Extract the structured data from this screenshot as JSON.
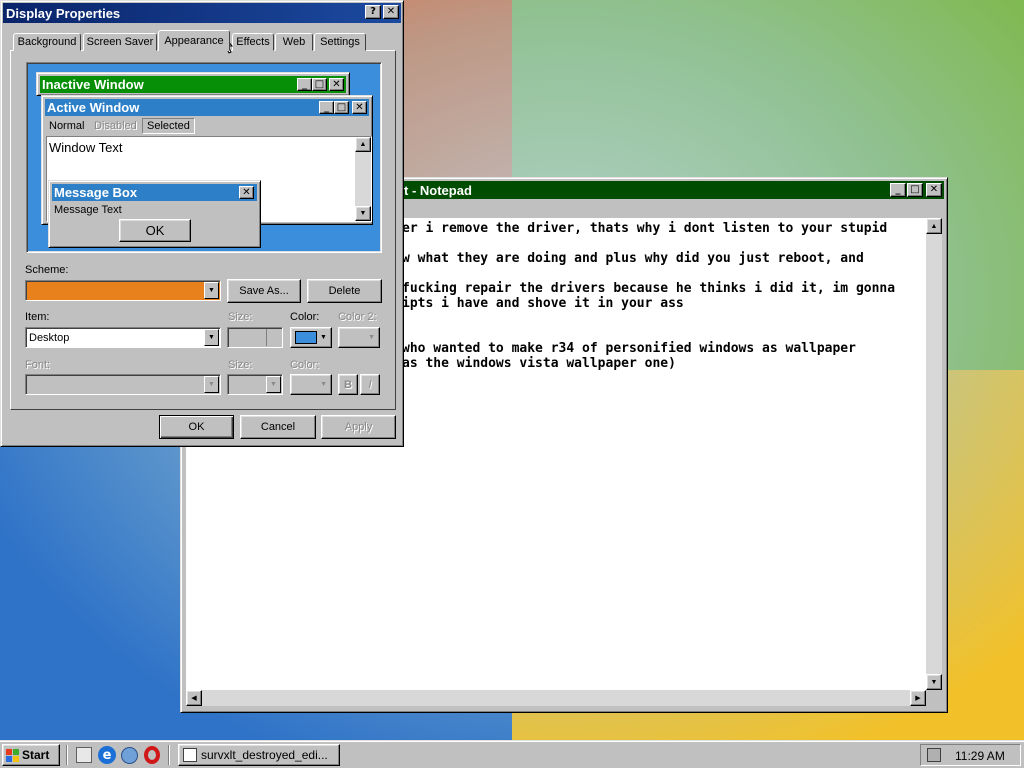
{
  "display_properties": {
    "title": "Display Properties",
    "help": "?",
    "close": "✕",
    "tabs": [
      "Background",
      "Screen Saver",
      "Appearance",
      "Effects",
      "Web",
      "Settings"
    ],
    "preview": {
      "inactive_title": "Inactive Window",
      "active_title": "Active Window",
      "menu": [
        "Normal",
        "Disabled",
        "Selected"
      ],
      "window_text": "Window Text",
      "message_box_title": "Message Box",
      "message_text": "Message Text",
      "ok": "OK"
    },
    "scheme_label": "Scheme:",
    "save_as": "Save As...",
    "delete": "Delete",
    "item_label": "Item:",
    "item_value": "Desktop",
    "size_label": "Size:",
    "color_label": "Color:",
    "color2_label": "Color 2:",
    "font_label": "Font:",
    "font_size_label": "Size:",
    "font_color_label": "Color:",
    "bold": "B",
    "italic": "I",
    "ok": "OK",
    "cancel": "Cancel",
    "apply": "Apply",
    "colors": {
      "scheme": "#e8801c",
      "item_color": "#3a8edb"
    }
  },
  "notepad": {
    "title": "t - Notepad",
    "lines": [
      "er i remove the driver, thats why i dont listen to your stupid",
      "",
      "w what they are doing and plus why did you just reboot, and",
      "",
      "fucking repair the drivers because he thinks i did it, im gonna",
      "ipts i have and shove it in your ass",
      "",
      "",
      "who wanted to make r34 of personified windows as wallpaper",
      "as the windows vista wallpaper one)"
    ]
  },
  "taskbar": {
    "start": "Start",
    "task": "survxlt_destroyed_edi...",
    "clock": "11:29 AM"
  }
}
